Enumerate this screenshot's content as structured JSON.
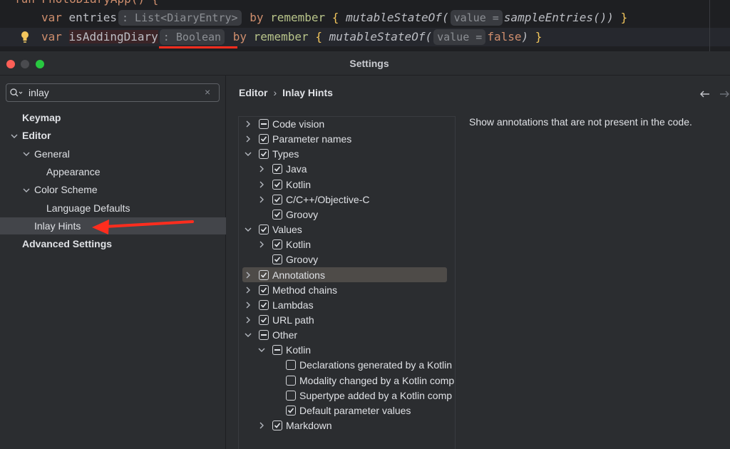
{
  "editor": {
    "line0": "fun PhotoDiaryApp() {",
    "line1": {
      "kw": "var",
      "name": "entries",
      "type_hint": ": List<DiaryEntry>",
      "by": "by",
      "remember": "remember",
      "open": "{",
      "fn": "mutableStateOf(",
      "param_hint": "value =",
      "arg": "sampleEntries()",
      "close": ")",
      "end": "}"
    },
    "line2": {
      "kw": "var",
      "name": "isAddingDiary",
      "type_hint": ": Boolean",
      "by": "by",
      "remember": "remember",
      "open": "{",
      "fn": "mutableStateOf(",
      "param_hint": "value =",
      "arg": "false",
      "close": ")",
      "end": "}"
    }
  },
  "window": {
    "title": "Settings"
  },
  "search": {
    "value": "inlay",
    "clear": "×"
  },
  "sidebar": {
    "items": [
      {
        "label": "Keymap"
      },
      {
        "label": "Editor"
      },
      {
        "label": "General"
      },
      {
        "label": "Appearance"
      },
      {
        "label": "Color Scheme"
      },
      {
        "label": "Language Defaults"
      },
      {
        "label": "Inlay Hints"
      },
      {
        "label": "Advanced Settings"
      }
    ]
  },
  "breadcrumb": {
    "parent": "Editor",
    "sep": "›",
    "current": "Inlay Hints"
  },
  "hints_tree": [
    {
      "label": "Code vision",
      "state": "mixed"
    },
    {
      "label": "Parameter names",
      "state": "checked"
    },
    {
      "label": "Types",
      "state": "checked"
    },
    {
      "label": "Java",
      "state": "checked"
    },
    {
      "label": "Kotlin",
      "state": "checked"
    },
    {
      "label": "C/C++/Objective-C",
      "state": "checked"
    },
    {
      "label": "Groovy",
      "state": "checked"
    },
    {
      "label": "Values",
      "state": "checked"
    },
    {
      "label": "Kotlin",
      "state": "checked"
    },
    {
      "label": "Groovy",
      "state": "checked"
    },
    {
      "label": "Annotations",
      "state": "checked"
    },
    {
      "label": "Method chains",
      "state": "checked"
    },
    {
      "label": "Lambdas",
      "state": "checked"
    },
    {
      "label": "URL path",
      "state": "checked"
    },
    {
      "label": "Other",
      "state": "mixed"
    },
    {
      "label": "Kotlin",
      "state": "mixed"
    },
    {
      "label": "Declarations generated by a Kotlin",
      "state": "unchecked"
    },
    {
      "label": "Modality changed by a Kotlin comp",
      "state": "unchecked"
    },
    {
      "label": "Supertype added by a Kotlin comp",
      "state": "unchecked"
    },
    {
      "label": "Default parameter values",
      "state": "checked"
    },
    {
      "label": "Markdown",
      "state": "checked"
    }
  ],
  "description": "Show annotations that are not present in the code.",
  "colors": {
    "accent_red": "#ff2d1e",
    "selection": "#43454a"
  },
  "icons": [
    "lightbulb-icon",
    "search-icon",
    "chevron-right-icon",
    "chevron-down-icon",
    "back-arrow-icon",
    "forward-arrow-icon",
    "checkbox-icon"
  ]
}
